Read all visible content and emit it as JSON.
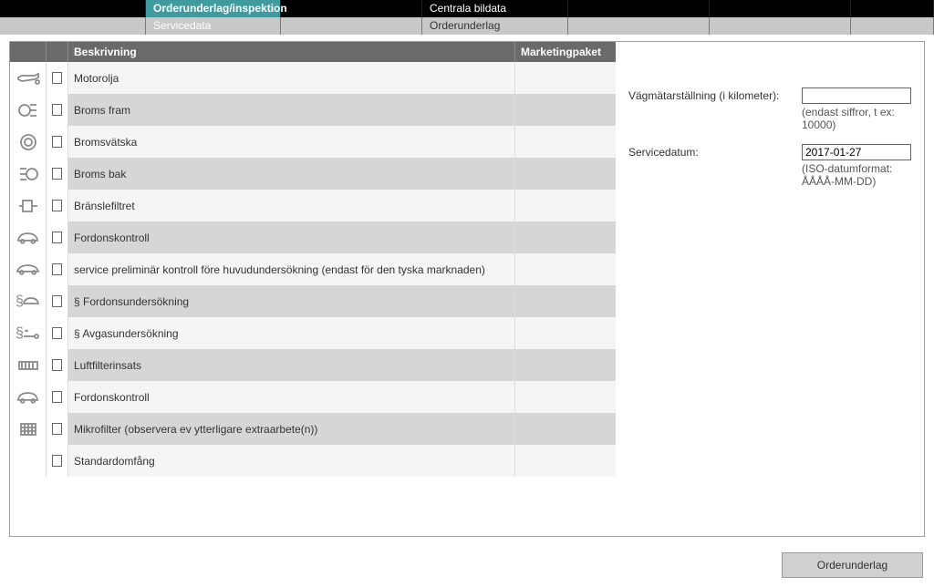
{
  "top": {
    "row1": {
      "tab_active": "Orderunderlag/inspektion",
      "col_center": "Centrala bildata"
    },
    "row2": {
      "tab_left": "Servicedata",
      "col_center": "Orderunderlag"
    }
  },
  "table": {
    "header": {
      "description": "Beskrivning",
      "marketing": "Marketingpaket"
    },
    "rows": [
      {
        "icon": "oil-can-icon",
        "label": "Motorolja",
        "marketing": ""
      },
      {
        "icon": "brake-front-icon",
        "label": "Broms fram",
        "marketing": ""
      },
      {
        "icon": "brake-disc-icon",
        "label": "Bromsvätska",
        "marketing": ""
      },
      {
        "icon": "brake-rear-icon",
        "label": "Broms bak",
        "marketing": ""
      },
      {
        "icon": "fuel-filter-icon",
        "label": "Bränslefiltret",
        "marketing": ""
      },
      {
        "icon": "car-check-icon",
        "label": "Fordonskontroll",
        "marketing": ""
      },
      {
        "icon": "car-outline-icon",
        "label": "service preliminär kontroll före huvudundersökning (endast för den tyska marknaden)",
        "marketing": ""
      },
      {
        "icon": "paragraph-car-icon",
        "label": "§ Fordonsundersökning",
        "marketing": ""
      },
      {
        "icon": "paragraph-exhaust-icon",
        "label": "§ Avgasundersökning",
        "marketing": ""
      },
      {
        "icon": "air-filter-icon",
        "label": "Luftfilterinsats",
        "marketing": ""
      },
      {
        "icon": "car-check-icon",
        "label": "Fordonskontroll",
        "marketing": ""
      },
      {
        "icon": "microfilter-icon",
        "label": "Mikrofilter (observera ev ytterligare extraarbete(n))",
        "marketing": ""
      },
      {
        "icon": "",
        "label": "Standardomfång",
        "marketing": ""
      }
    ]
  },
  "right": {
    "mileage_label": "Vägmätarställning (i kilometer):",
    "mileage_value": "",
    "mileage_help": "(endast siffror, t ex: 10000)",
    "date_label": "Servicedatum:",
    "date_value": "2017-01-27",
    "date_help": "(ISO-datumformat: ÅÅÅÅ-MM-DD)"
  },
  "footer": {
    "button": "Orderunderlag"
  }
}
